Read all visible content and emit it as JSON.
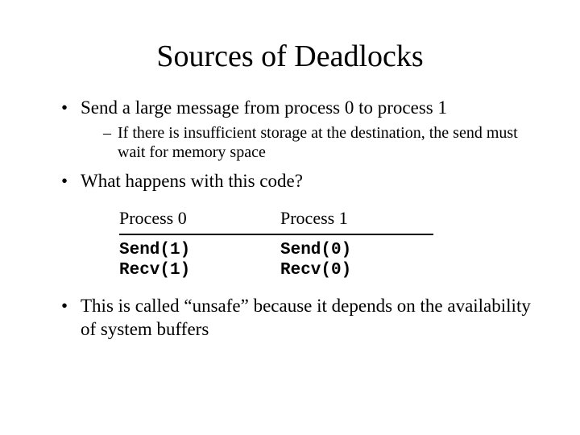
{
  "title": "Sources of Deadlocks",
  "bullets": {
    "b1": "Send a large message from process 0 to process 1",
    "b1_sub": "If there is insufficient storage at the destination, the send must wait for memory space",
    "b2": "What happens with this code?",
    "b3": "This is called “unsafe” because it depends on the availability of system buffers"
  },
  "table": {
    "h0": "Process 0",
    "h1": "Process 1",
    "p0l1": "Send(1)",
    "p0l2": "Recv(1)",
    "p1l1": "Send(0)",
    "p1l2": "Recv(0)"
  }
}
